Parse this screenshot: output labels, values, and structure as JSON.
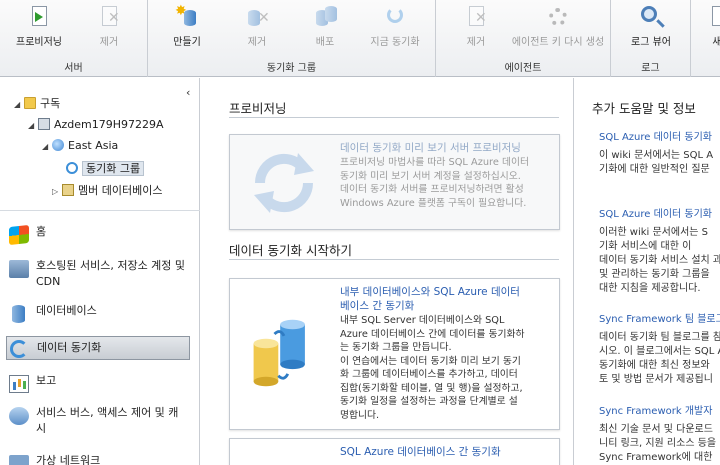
{
  "ribbon": {
    "groups": [
      {
        "label": "서버",
        "buttons": [
          {
            "label": "프로비저닝",
            "enabled": true,
            "icon": "provision-icon"
          },
          {
            "label": "제거",
            "enabled": false,
            "icon": "remove-icon"
          }
        ]
      },
      {
        "label": "동기화 그룹",
        "buttons": [
          {
            "label": "만들기",
            "enabled": true,
            "icon": "create-icon"
          },
          {
            "label": "제거",
            "enabled": false,
            "icon": "remove-icon"
          },
          {
            "label": "배포",
            "enabled": false,
            "icon": "deploy-icon"
          },
          {
            "label": "지금 동기화",
            "enabled": false,
            "icon": "sync-now-icon"
          }
        ]
      },
      {
        "label": "에이전트",
        "buttons": [
          {
            "label": "제거",
            "enabled": false,
            "icon": "remove-icon"
          },
          {
            "label": "에이전트 키 다시 생성",
            "enabled": false,
            "icon": "regenerate-key-icon"
          }
        ]
      },
      {
        "label": "로그",
        "buttons": [
          {
            "label": "로그 뷰어",
            "enabled": true,
            "icon": "log-viewer-icon"
          }
        ]
      },
      {
        "label": "",
        "buttons": [
          {
            "label": "새",
            "enabled": true,
            "icon": "new-icon"
          }
        ]
      }
    ]
  },
  "tree": {
    "root": "구독",
    "subscription": "Azdem179H97229A",
    "region": "East Asia",
    "sync_group": "동기화 그룹",
    "member_db": "멤버 데이터베이스"
  },
  "nav": {
    "items": [
      {
        "label": "홈",
        "icon": "windows-icon"
      },
      {
        "label": "호스팅된 서비스, 저장소 계정 및 CDN",
        "icon": "hosted-services-icon"
      },
      {
        "label": "데이터베이스",
        "icon": "database-icon"
      },
      {
        "label": "데이터 동기화",
        "icon": "data-sync-icon",
        "active": true
      },
      {
        "label": "보고",
        "icon": "report-icon"
      },
      {
        "label": "서비스 버스, 액세스 제어 및 캐시",
        "icon": "service-bus-icon"
      },
      {
        "label": "가상 네트워크",
        "icon": "virtual-network-icon"
      }
    ]
  },
  "content": {
    "provision_heading": "프로비저닝",
    "provision_card": {
      "title": "데이터 동기화 미리 보기 서버 프로비저닝",
      "lines": [
        "프로비저닝 마법사를 따라 SQL Azure 데이터",
        "동기화 미리 보기 서버 계정을 설정하십시오.",
        "데이터 동기화 서버를 프로비저닝하려면 활성",
        "Windows Azure 플랫폼 구독이 필요합니다."
      ]
    },
    "start_heading": "데이터 동기화 시작하기",
    "sync_card": {
      "title_lines": [
        "내부 데이터베이스와 SQL Azure 데이터",
        "베이스 간 동기화"
      ],
      "lines": [
        "내부 SQL Server 데이터베이스와 SQL",
        "Azure 데이터베이스 간에 데이터를 동기화하",
        "는 동기화 그룹을 만듭니다.",
        "이 연습에서는 데이터 동기화 미리 보기 동기",
        "화 그룹에 데이터베이스를 추가하고, 데이터",
        "집합(동기화할 테이블, 열 및 행)을 설정하고,",
        "동기화 일정을 설정하는 과정을 단계별로 설",
        "명합니다."
      ]
    },
    "azure_card_title": "SQL Azure 데이터베이스 간 동기화"
  },
  "help": {
    "title": "추가 도움말 및 정보",
    "items": [
      {
        "link": "SQL Azure 데이터 동기화",
        "lines": [
          "이 wiki 문서에서는 SQL A",
          "기화에 대한 일반적인 질문"
        ]
      },
      {
        "link": "SQL Azure 데이터 동기화",
        "lines": [
          "이러한 wiki 문서에서는 S",
          "기화 서비스에 대한 이",
          "데이터 동기화 서비스 설치 과정과",
          "및 관리하는 동기화 그룹을",
          "대한 지침을 제공합니다."
        ]
      },
      {
        "link": "Sync Framework 팀 블로그",
        "lines": [
          "데이터 동기화 팀 블로그를 참조하",
          "시오. 이 블로그에서는 SQL A",
          "동기화에 대한 최신 정보와",
          "토 및 방법 문서가 제공됩니"
        ]
      },
      {
        "link": "Sync Framework 개발자",
        "lines": [
          "최신 기술 문서 및 다운로드",
          "니티 링크, 지원 리소스 등을",
          "Sync Framework에 대한"
        ]
      }
    ]
  }
}
